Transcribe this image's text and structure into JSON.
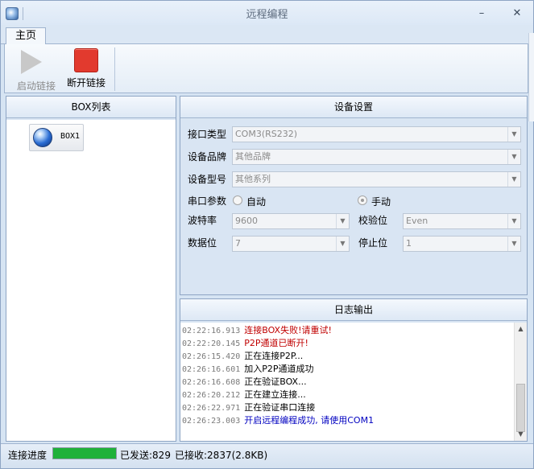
{
  "window": {
    "title": "远程编程",
    "minimize_label": "–",
    "maximize_label": "□",
    "close_label": "✕"
  },
  "ribbon": {
    "tab_home": "主页",
    "start_label": "启动链接",
    "disconnect_label": "断开链接"
  },
  "box_list": {
    "title": "BOX列表",
    "items": [
      {
        "label": "BOX1"
      }
    ]
  },
  "settings": {
    "title": "设备设置",
    "port_type_label": "接口类型",
    "port_type_value": "COM3(RS232)",
    "brand_label": "设备品牌",
    "brand_value": "其他品牌",
    "model_label": "设备型号",
    "model_value": "其他系列",
    "serial_params_label": "串口参数",
    "auto_label": "自动",
    "manual_label": "手动",
    "baud_label": "波特率",
    "baud_value": "9600",
    "parity_label": "校验位",
    "parity_value": "Even",
    "databits_label": "数据位",
    "databits_value": "7",
    "stopbits_label": "停止位",
    "stopbits_value": "1",
    "arrow": "▼"
  },
  "log": {
    "title": "日志输出",
    "lines": [
      {
        "time": "02:22:16.913",
        "message": "连接BOX失败!请重试!",
        "color": "#c00000"
      },
      {
        "time": "02:22:20.145",
        "message": "P2P通道已断开!",
        "color": "#c00000"
      },
      {
        "time": "02:26:15.420",
        "message": "正在连接P2P...",
        "color": "#000000"
      },
      {
        "time": "02:26:16.601",
        "message": "加入P2P通道成功",
        "color": "#000000"
      },
      {
        "time": "02:26:16.608",
        "message": "正在验证BOX...",
        "color": "#000000"
      },
      {
        "time": "02:26:20.212",
        "message": "正在建立连接...",
        "color": "#000000"
      },
      {
        "time": "02:26:22.971",
        "message": "正在验证串口连接",
        "color": "#000000"
      },
      {
        "time": "02:26:23.003",
        "message": "开启远程编程成功, 请使用COM1",
        "color": "#0000c0"
      }
    ],
    "scroll_up": "▲",
    "scroll_down": "▼"
  },
  "status": {
    "progress_label": "连接进度",
    "progress_value": 1.0,
    "sent": "已发送:829",
    "received": "已接收:2837(2.8KB)"
  }
}
